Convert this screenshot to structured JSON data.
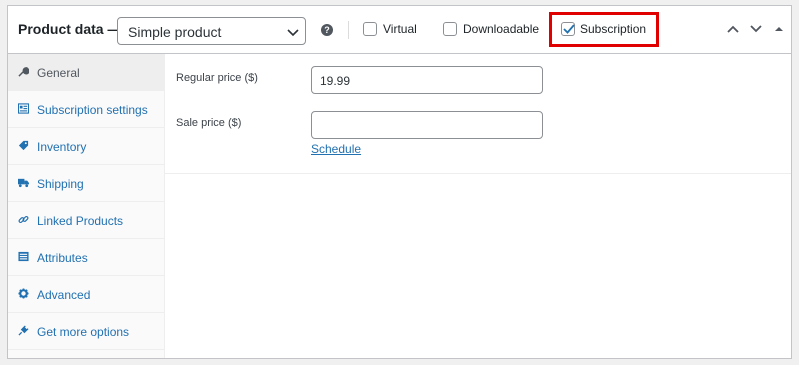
{
  "header": {
    "title": "Product data —",
    "product_type": "Simple product",
    "help": "?",
    "checkboxes": [
      {
        "label": "Virtual",
        "checked": false
      },
      {
        "label": "Downloadable",
        "checked": false
      },
      {
        "label": "Subscription",
        "checked": true
      }
    ],
    "highlight_color": "#e00000"
  },
  "sidebar": {
    "items": [
      {
        "label": "General",
        "icon": "wrench-icon",
        "active": true
      },
      {
        "label": "Subscription settings",
        "icon": "subscription-icon",
        "active": false
      },
      {
        "label": "Inventory",
        "icon": "tag-icon",
        "active": false
      },
      {
        "label": "Shipping",
        "icon": "truck-icon",
        "active": false
      },
      {
        "label": "Linked Products",
        "icon": "link-icon",
        "active": false
      },
      {
        "label": "Attributes",
        "icon": "list-icon",
        "active": false
      },
      {
        "label": "Advanced",
        "icon": "gear-icon",
        "active": false
      },
      {
        "label": "Get more options",
        "icon": "plug-icon",
        "active": false
      }
    ]
  },
  "general": {
    "regular_price_label": "Regular price ($)",
    "regular_price_value": "19.99",
    "sale_price_label": "Sale price ($)",
    "sale_price_value": "",
    "schedule_link": "Schedule"
  },
  "colors": {
    "link": "#2271b1",
    "border": "#c3c4c7"
  }
}
